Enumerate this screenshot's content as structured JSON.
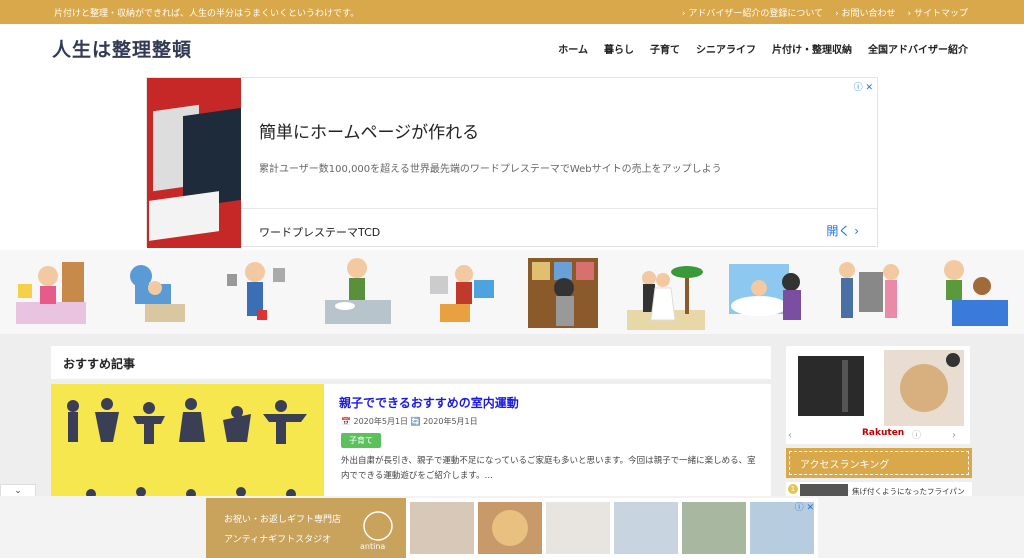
{
  "topbar": {
    "tagline": "片付けと整理・収納ができれば、人生の半分はうまくいくというわけです。",
    "links": [
      "› アドバイザー紹介の登録について",
      "› お問い合わせ",
      "› サイトマップ"
    ]
  },
  "header": {
    "logo": "人生は整理整頓",
    "nav": [
      "ホーム",
      "暮らし",
      "子育て",
      "シニアライフ",
      "片付け・整理収納",
      "全国アドバイザー紹介"
    ]
  },
  "ad": {
    "title": "簡単にホームページが作れる",
    "description": "累計ユーザー数100,000を超える世界最先端のワードプレステーマでWebサイトの売上をアップしよう",
    "brand": "ワードプレステーマTCD",
    "open_label": "開く",
    "close_label": "ⓘ ✕"
  },
  "main": {
    "section_title": "おすすめ記事",
    "article": {
      "title": "親子でできるおすすめの室内運動",
      "date": "📅 2020年5月1日  🔄 2020年5月1日",
      "tag": "子育て",
      "excerpt": "外出自粛が長引き、親子で運動不足になっているご家庭も多いと思います。今回は親子で一緒に楽しめる、室内でできる運動遊びをご紹介します。…"
    }
  },
  "sidebar": {
    "ad_brand": "Rakuten",
    "ranking_title": "アクセスランキング",
    "rank1_text": "焦げ付くようになったフライパン"
  },
  "bottom_ad": {
    "line1": "お祝い・お返しギフト専門店",
    "line2": "アンティナギフトスタジオ",
    "logo_text": "antina"
  },
  "colors": {
    "accent": "#d8a84a",
    "tag_green": "#5cc15c",
    "link_blue": "#1a1ae0"
  }
}
